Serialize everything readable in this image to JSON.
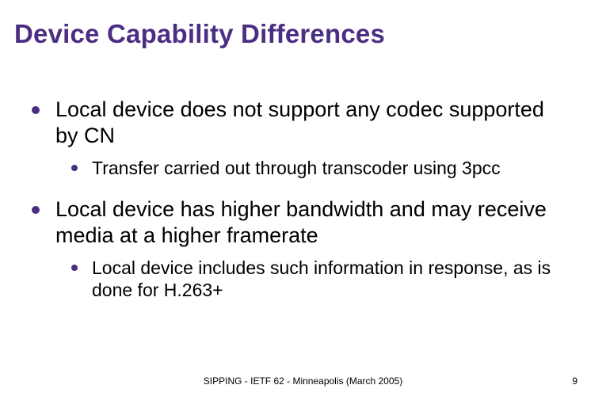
{
  "title": "Device Capability Differences",
  "bullets": [
    {
      "text": "Local device does not support any codec supported by CN",
      "sub": [
        "Transfer carried out through transcoder using 3pcc"
      ]
    },
    {
      "text": "Local device has higher bandwidth and may receive media at a higher framerate",
      "sub": [
        "Local device includes such information in response, as is done for H.263+"
      ]
    }
  ],
  "footer": "SIPPING - IETF 62 - Minneapolis (March 2005)",
  "page_number": "9"
}
